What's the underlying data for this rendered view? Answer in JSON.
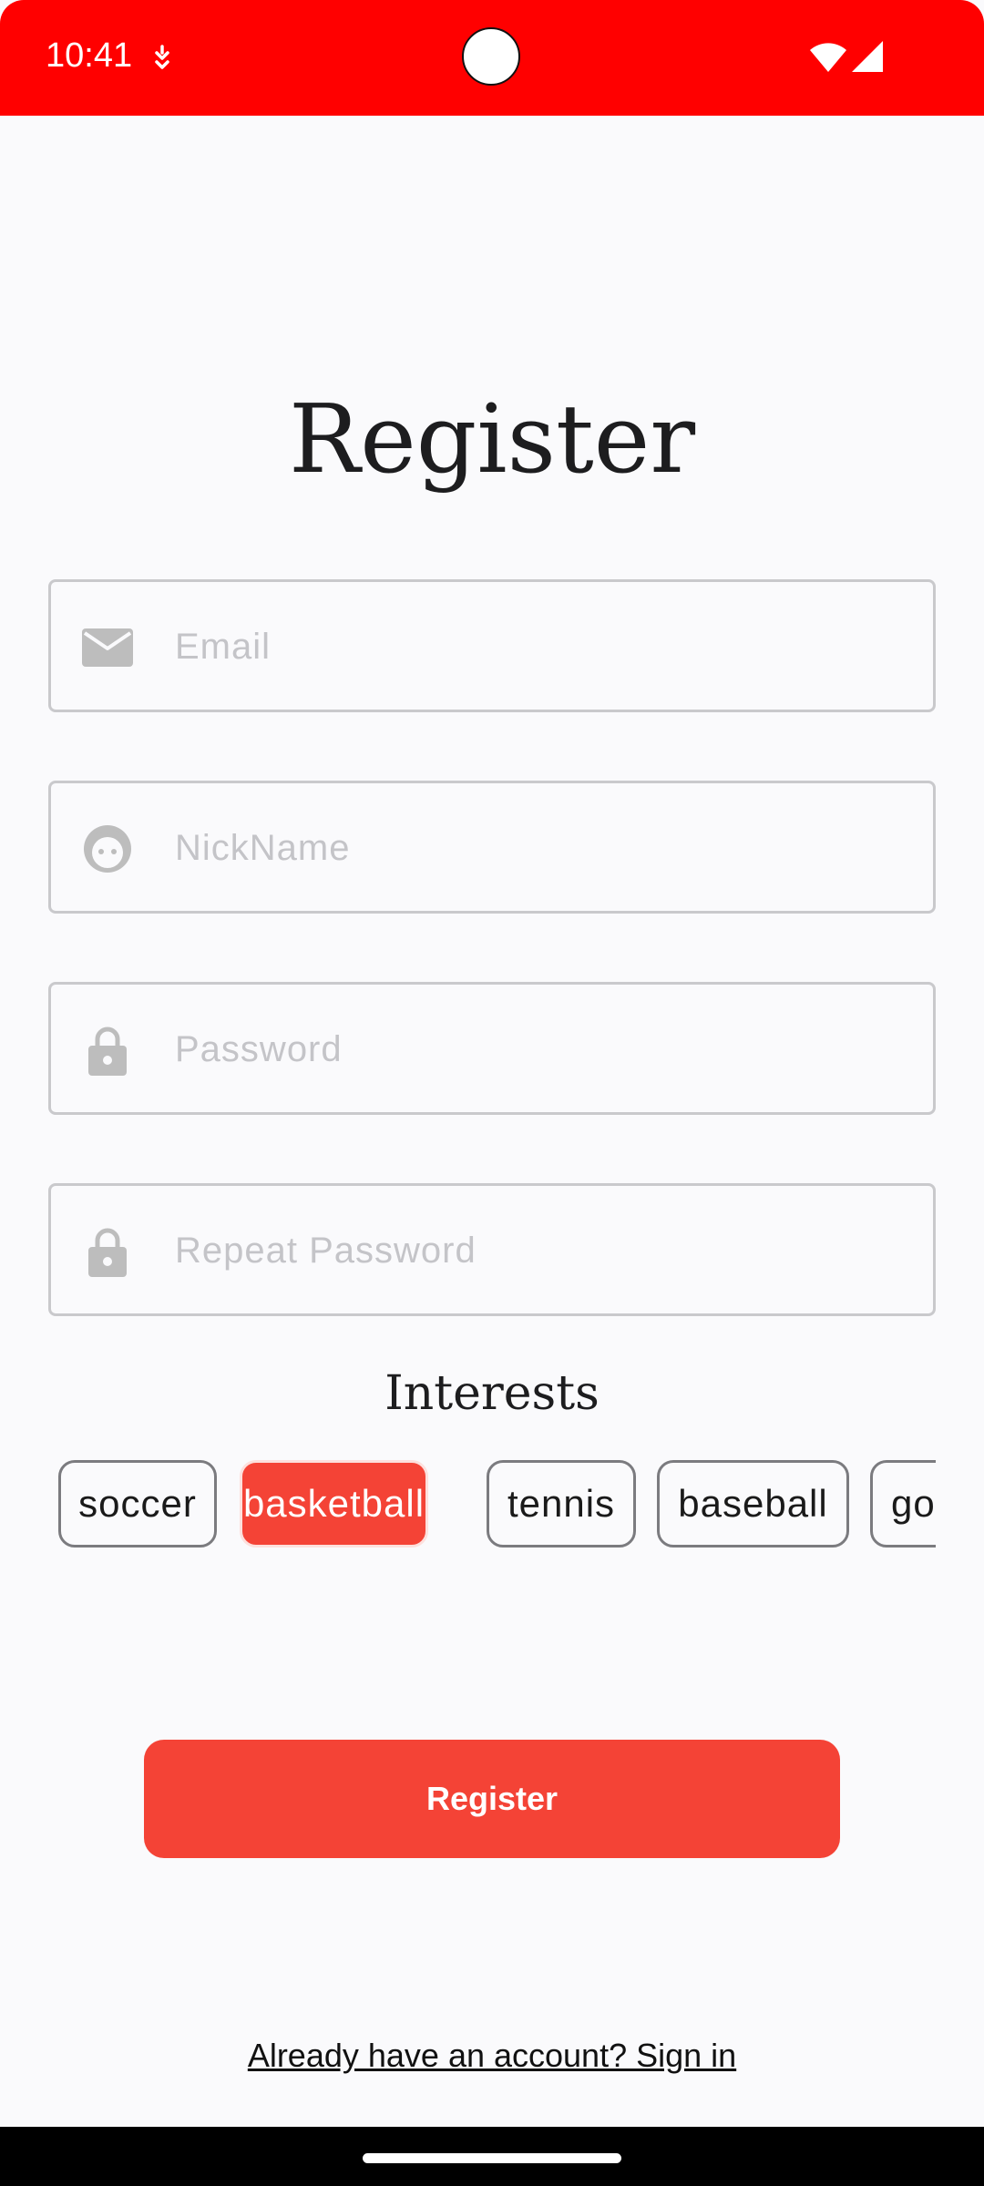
{
  "status_bar": {
    "time": "10:41",
    "icons": [
      "notification-icon",
      "wifi-icon",
      "signal-icon"
    ]
  },
  "page": {
    "title": "Register"
  },
  "form": {
    "email": {
      "placeholder": "Email",
      "value": "",
      "icon": "email-icon"
    },
    "nickname": {
      "placeholder": "NickName",
      "value": "",
      "icon": "face-icon"
    },
    "password": {
      "placeholder": "Password",
      "value": "",
      "icon": "lock-icon"
    },
    "repeat_password": {
      "placeholder": "Repeat Password",
      "value": "",
      "icon": "lock-icon"
    }
  },
  "interests": {
    "label": "Interests",
    "chips": [
      {
        "label": "soccer",
        "selected": false
      },
      {
        "label": "basketball",
        "selected": true
      },
      {
        "label": "tennis",
        "selected": false
      },
      {
        "label": "baseball",
        "selected": false
      },
      {
        "label": "golf",
        "selected": false
      }
    ]
  },
  "actions": {
    "register_label": "Register",
    "signin_label": "Already have an account? Sign in"
  },
  "colors": {
    "status_bar": "#ff0000",
    "accent": "#f44336",
    "background": "#fafafc"
  }
}
